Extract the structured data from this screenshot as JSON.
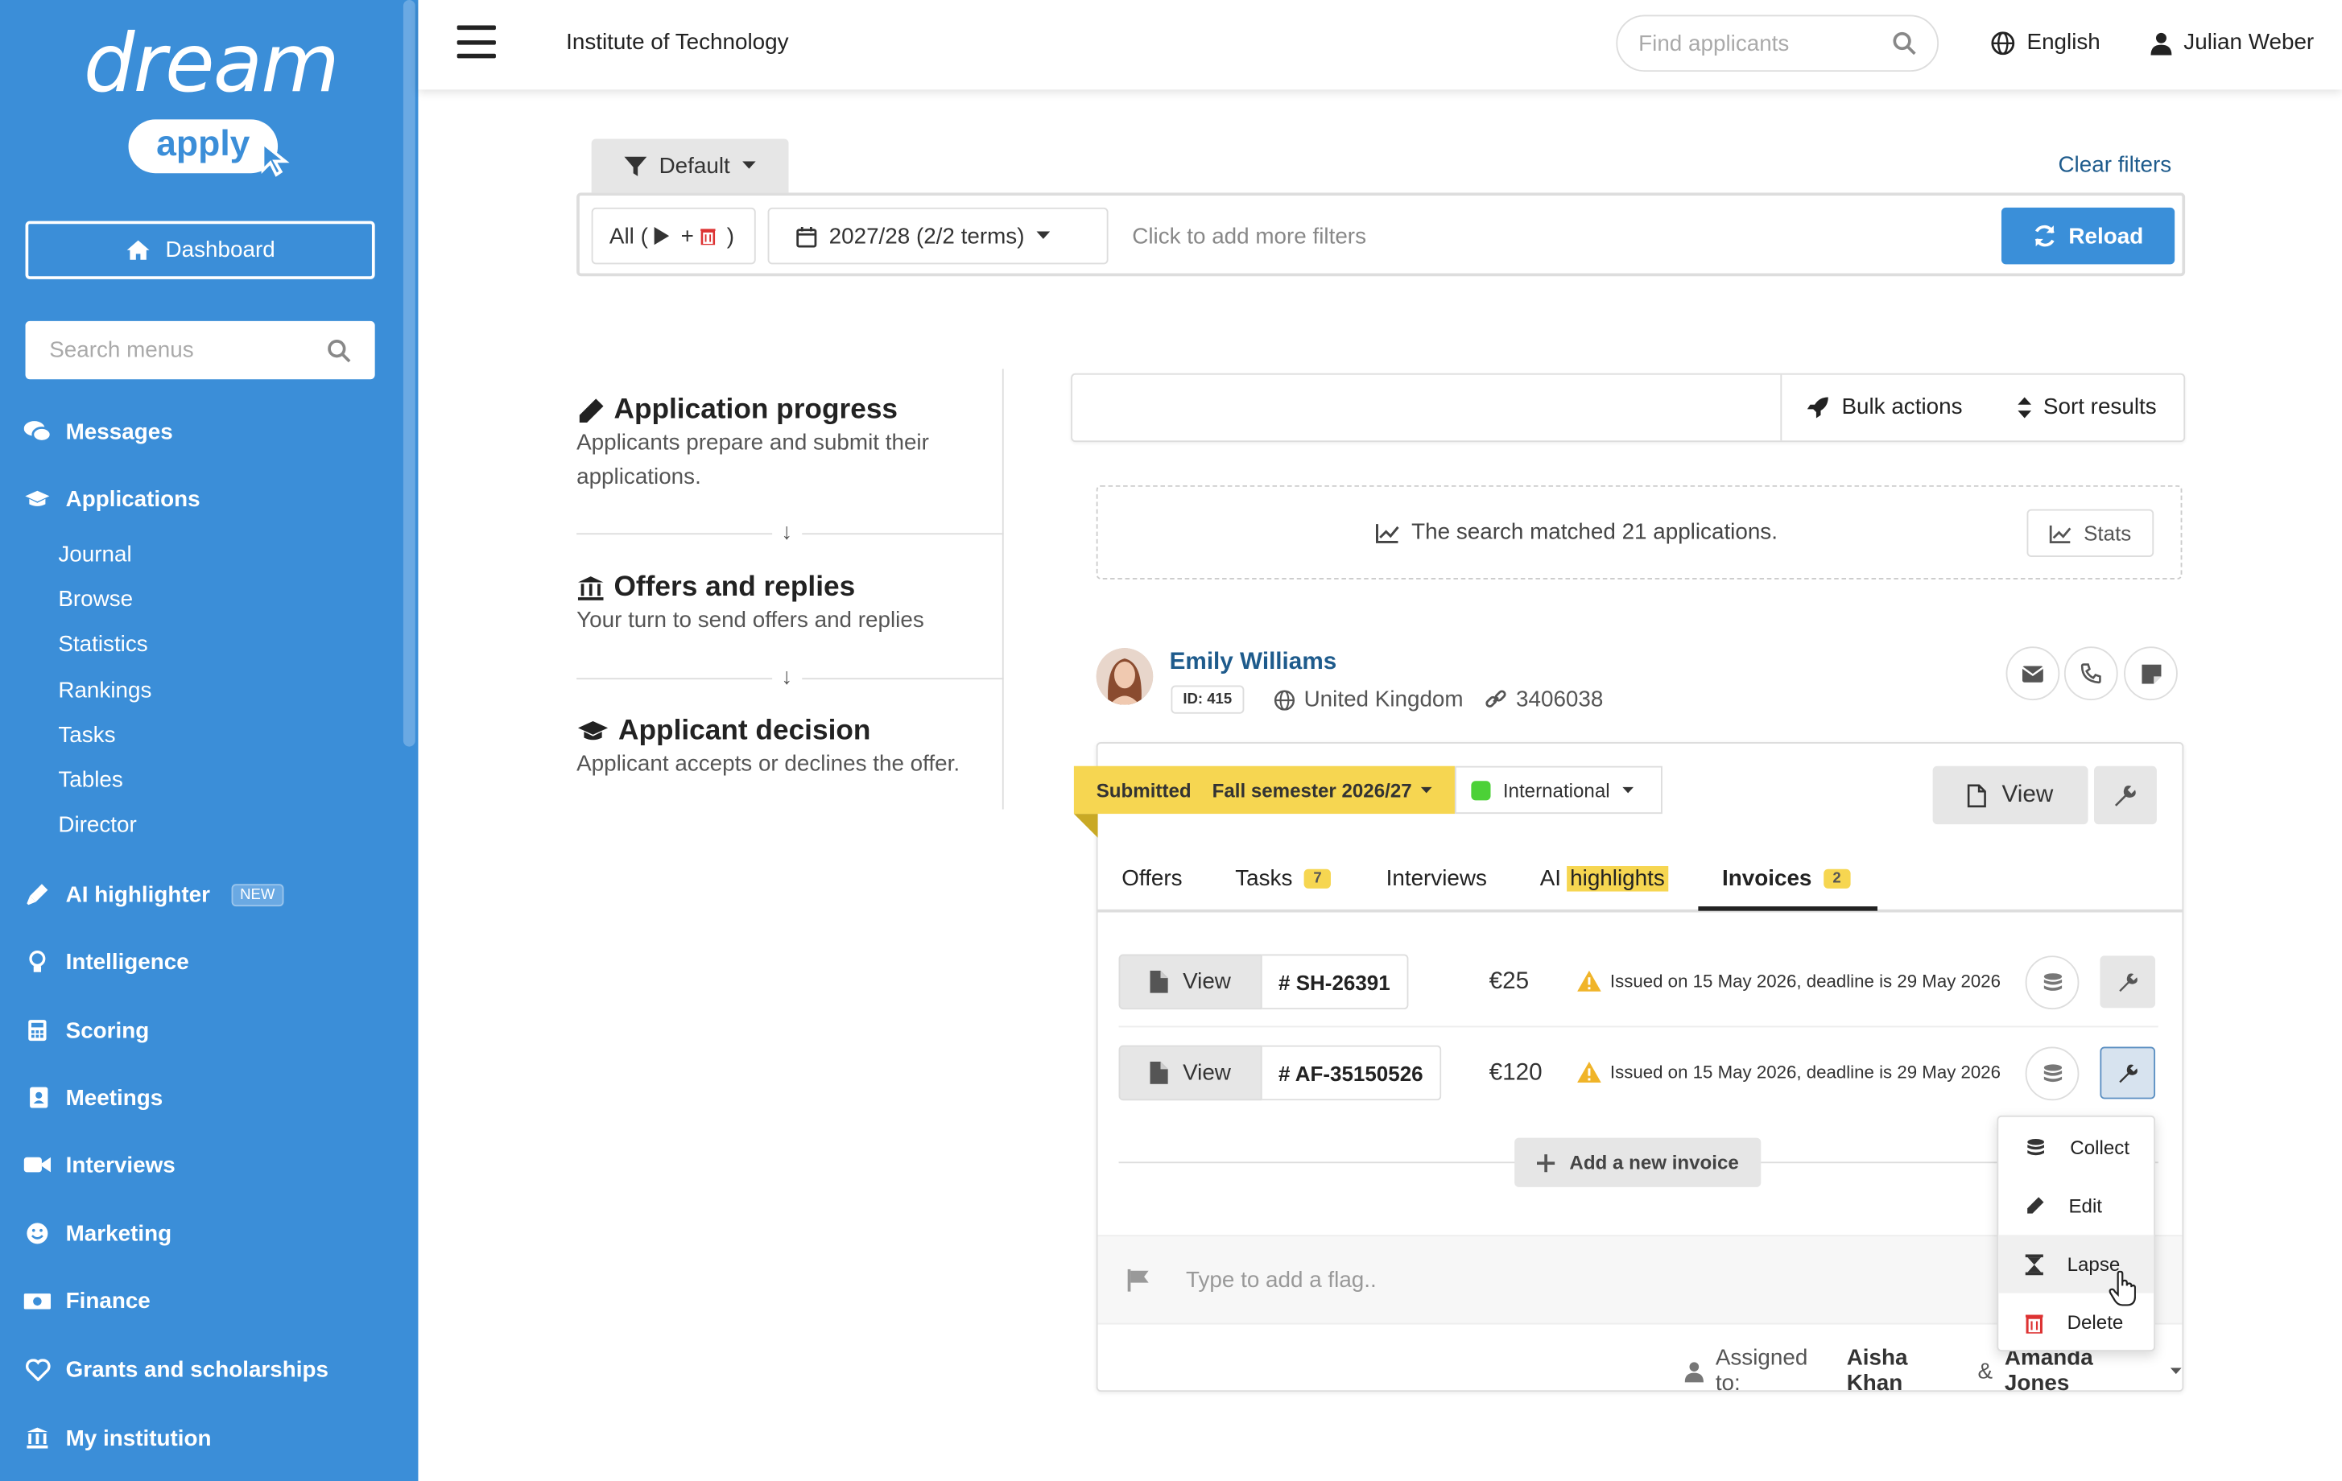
{
  "logo": {
    "word": "dream",
    "pill": "apply"
  },
  "sidebar": {
    "dashboard": "Dashboard",
    "search_placeholder": "Search menus",
    "items": [
      {
        "label": "Messages",
        "icon": "comments-icon"
      },
      {
        "label": "Applications",
        "icon": "graduation-cap-icon"
      },
      {
        "label": "AI highlighter",
        "icon": "highlighter-icon",
        "badge": "NEW"
      },
      {
        "label": "Intelligence",
        "icon": "lightbulb-icon"
      },
      {
        "label": "Scoring",
        "icon": "calculator-icon"
      },
      {
        "label": "Meetings",
        "icon": "address-book-icon"
      },
      {
        "label": "Interviews",
        "icon": "video-icon"
      },
      {
        "label": "Marketing",
        "icon": "smile-icon"
      },
      {
        "label": "Finance",
        "icon": "money-icon"
      },
      {
        "label": "Grants and scholarships",
        "icon": "heart-icon"
      },
      {
        "label": "My institution",
        "icon": "institution-icon"
      }
    ],
    "subitems": [
      "Journal",
      "Browse",
      "Statistics",
      "Rankings",
      "Tasks",
      "Tables",
      "Director"
    ]
  },
  "topbar": {
    "institution": "Institute of Technology",
    "find_placeholder": "Find applicants",
    "language": "English",
    "user": "Julian Weber"
  },
  "filters": {
    "preset": "Default",
    "clear": "Clear filters",
    "all_prefix": "All (",
    "all_plus": "+",
    "all_suffix": ")",
    "term": "2027/28 (2/2 terms)",
    "more": "Click to add more filters",
    "reload": "Reload"
  },
  "steps": [
    {
      "title": "Application progress",
      "desc": "Applicants prepare and submit their applications."
    },
    {
      "title": "Offers and replies",
      "desc": "Your turn to send offers and replies"
    },
    {
      "title": "Applicant decision",
      "desc": "Applicant accepts or declines the offer."
    }
  ],
  "results": {
    "bulk": "Bulk actions",
    "sort": "Sort results",
    "matched": "The search matched 21 applications.",
    "stats": "Stats"
  },
  "applicant": {
    "name": "Emily Williams",
    "id": "ID: 415",
    "country": "United Kingdom",
    "ref": "3406038"
  },
  "card": {
    "status": "Submitted",
    "term": "Fall semester 2026/27",
    "group": "International",
    "view": "View",
    "tabs": [
      {
        "label": "Offers"
      },
      {
        "label": "Tasks",
        "count": "7"
      },
      {
        "label": "Interviews"
      },
      {
        "label_a": "AI",
        "label_b": "highlights"
      },
      {
        "label": "Invoices",
        "count": "2"
      }
    ],
    "invoices": [
      {
        "view": "View",
        "number": "# SH-26391",
        "amount": "€25",
        "note": "Issued on 15 May 2026, deadline is 29 May 2026"
      },
      {
        "view": "View",
        "number": "# AF-35150526",
        "amount": "€120",
        "note": "Issued on 15 May 2026, deadline is 29 May 2026"
      }
    ],
    "add_invoice": "Add a new invoice",
    "flag_placeholder": "Type to add a flag..",
    "assigned_label": "Assigned to:",
    "assigned_a": "Aisha Khan",
    "assigned_amp": "&",
    "assigned_b": "Amanda Jones"
  },
  "menu": {
    "items": [
      "Collect",
      "Edit",
      "Lapse",
      "Delete"
    ]
  },
  "colors": {
    "sidebar": "#3b8ed8",
    "accent": "#3a8fd9",
    "highlight": "#f6d651",
    "link": "#1e5b8c"
  }
}
